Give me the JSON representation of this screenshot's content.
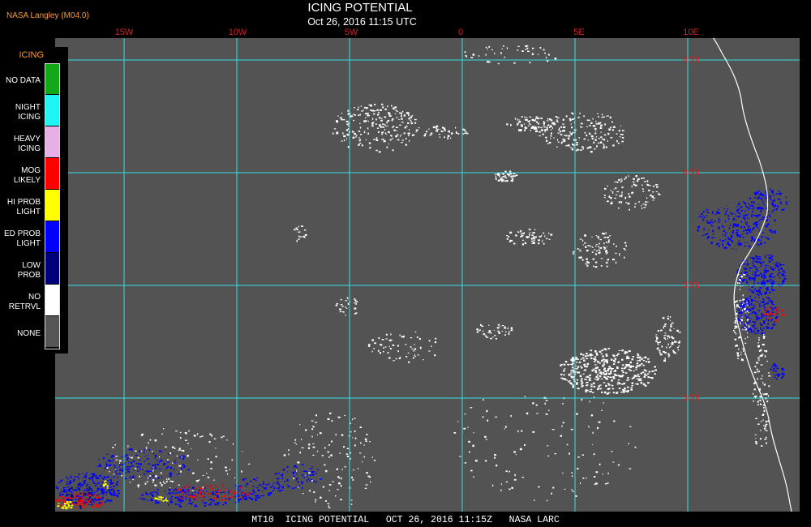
{
  "header": {
    "source": "NASA Langley (M04.0)",
    "title": "ICING POTENTIAL",
    "subtitle": "Oct 26, 2016 11:15 UTC"
  },
  "legend": {
    "title": "ICING",
    "items": [
      {
        "label": "NO DATA",
        "color": "#12a81a"
      },
      {
        "label": "NIGHT\nICING",
        "color": "#1ff4f4"
      },
      {
        "label": "HEAVY\nICING",
        "color": "#e7b0e4"
      },
      {
        "label": "MOG\nLIKELY",
        "color": "#ff0000"
      },
      {
        "label": "HI PROB\nLIGHT",
        "color": "#ffff00"
      },
      {
        "label": "ED PROB\nLIGHT",
        "color": "#0000ff"
      },
      {
        "label": "LOW\nPROB",
        "color": "#00007a"
      },
      {
        "label": "NO\nRETRVL",
        "color": "#ffffff"
      },
      {
        "label": "NONE",
        "color": "#555555"
      }
    ]
  },
  "map": {
    "longitude_labels": [
      "15W",
      "10W",
      "5W",
      "0",
      "5E",
      "10E"
    ],
    "latitude_labels": [
      "45N",
      "40N",
      "35N",
      "30N"
    ],
    "grid_color": "#31e0e0",
    "background_color": "#535353",
    "coastline_color": "#ffffff"
  },
  "footer": {
    "text": "MT10  ICING POTENTIAL   OCT 26, 2016 11:15Z   NASA LARC"
  }
}
